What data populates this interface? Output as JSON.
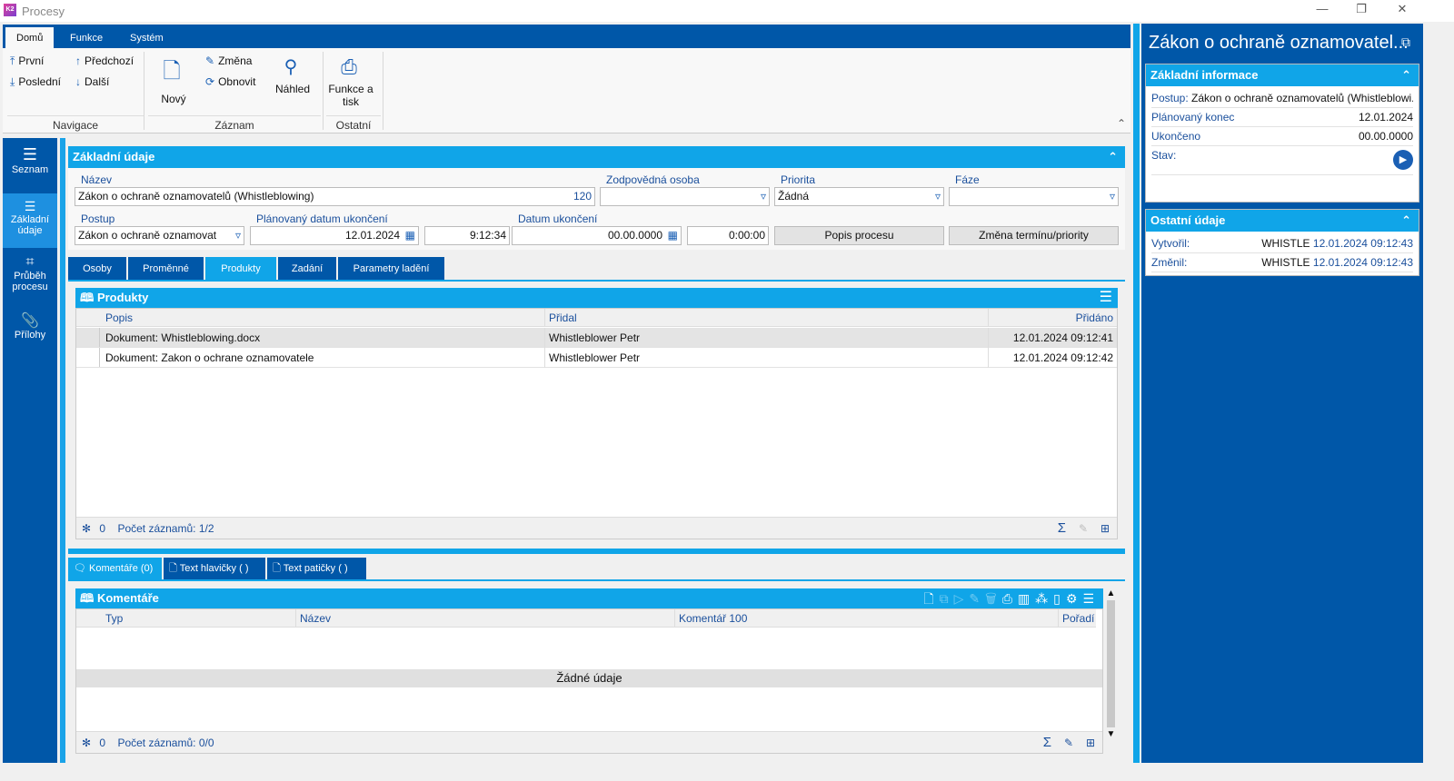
{
  "window": {
    "title": "Procesy",
    "logo": "K2",
    "minimize": "—",
    "restore": "❐",
    "close": "✕"
  },
  "ribbon": {
    "tabs": [
      "Domů",
      "Funkce",
      "Systém"
    ],
    "nav": {
      "first": "První",
      "prev": "Předchozí",
      "last": "Poslední",
      "next": "Další",
      "group": "Navigace"
    },
    "record": {
      "new": "Nový",
      "change": "Změna",
      "refresh": "Obnovit",
      "preview": "Náhled",
      "group": "Záznam"
    },
    "other": {
      "print": "Funkce a tisk",
      "group": "Ostatní"
    }
  },
  "sidebar": {
    "items": [
      "Seznam",
      "Základní údaje",
      "Průběh procesu",
      "Přílohy"
    ]
  },
  "basic": {
    "title": "Základní údaje",
    "name_label": "Název",
    "name_value": "Zákon o ochraně oznamovatelů (Whistleblowing)",
    "name_num": "120",
    "resp_label": "Zodpovědná osoba",
    "resp_value": "",
    "priority_label": "Priorita",
    "priority_value": "Žádná",
    "phase_label": "Fáze",
    "phase_value": "",
    "proc_label": "Postup",
    "proc_value": "Zákon o ochraně oznamovat",
    "planned_label": "Plánovaný datum ukončení",
    "planned_date": "12.01.2024",
    "planned_time": "9:12:34",
    "end_label": "Datum ukončení",
    "end_date": "00.00.0000",
    "end_time": "0:00:00",
    "btn_desc": "Popis procesu",
    "btn_change": "Změna termínu/priority"
  },
  "tabs": [
    "Osoby",
    "Proměnné",
    "Produkty",
    "Zadání",
    "Parametry ladění"
  ],
  "products": {
    "title": "Produkty",
    "columns": [
      "Popis",
      "Přidal",
      "Přidáno"
    ],
    "rows": [
      [
        "Dokument: Whistleblowing.docx",
        "Whistleblower Petr",
        "12.01.2024 09:12:41"
      ],
      [
        "Dokument: Zakon o ochrane oznamovatele",
        "Whistleblower Petr",
        "12.01.2024 09:12:42"
      ]
    ],
    "sel": "0",
    "count": "Počet záznamů: 1/2"
  },
  "bottom_tabs": [
    "Komentáře (0)",
    "Text hlavičky ( )",
    "Text patičky ( )"
  ],
  "comments": {
    "title": "Komentáře",
    "columns": [
      "Typ",
      "Název",
      "Komentář 100",
      "Pořadí"
    ],
    "empty": "Žádné údaje",
    "sel": "0",
    "count": "Počet záznamů: 0/0"
  },
  "right": {
    "title": "Zákon o ochraně oznamovatel...",
    "basic_title": "Základní informace",
    "postup_label": "Postup:",
    "postup_value": "Zákon o ochraně oznamovatelů (Whistleblowi...",
    "planned_label": "Plánovaný konec",
    "planned_value": "12.01.2024",
    "ended_label": "Ukončeno",
    "ended_value": "00.00.0000",
    "state_label": "Stav:",
    "other_title": "Ostatní údaje",
    "created_label": "Vytvořil:",
    "created_user": "WHISTLE",
    "created_date": "12.01.2024 09:12:43",
    "changed_label": "Změnil:",
    "changed_user": "WHISTLE",
    "changed_date": "12.01.2024 09:12:43"
  },
  "colors": {
    "dark_blue": "#0057a8",
    "light_blue": "#10a5e8"
  }
}
